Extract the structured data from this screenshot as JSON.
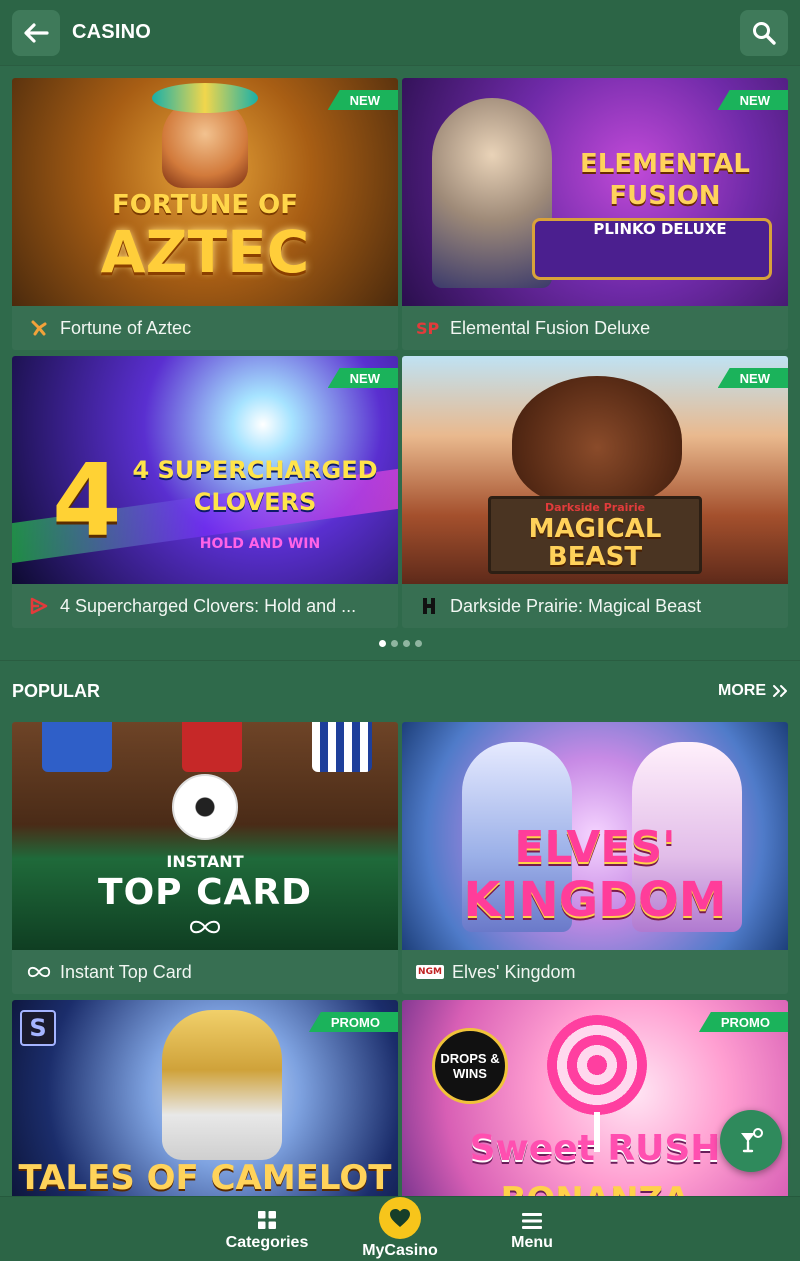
{
  "header": {
    "title": "CASINO",
    "back_icon": "arrow-left-icon",
    "search_icon": "search-icon"
  },
  "featured": [
    {
      "name": "Fortune of Aztec",
      "badge": "NEW",
      "art_line1": "FORTUNE OF",
      "art_line2": "AZTEC"
    },
    {
      "name": "Elemental Fusion Deluxe",
      "badge": "NEW",
      "art_line1": "ELEMENTAL FUSION",
      "art_line2": "PLINKO DELUXE"
    },
    {
      "name": "4 Supercharged Clovers: Hold and ...",
      "badge": "NEW",
      "art_line1": "4 SUPERCHARGED CLOVERS",
      "art_line2": "HOLD AND WIN"
    },
    {
      "name": "Darkside Prairie: Magical Beast",
      "badge": "NEW",
      "art_line0": "Darkside Prairie",
      "art_line1": "MAGICAL",
      "art_line2": "BEAST"
    }
  ],
  "carousel": {
    "pages": 4,
    "active": 0
  },
  "popular": {
    "title": "POPULAR",
    "more_label": "MORE",
    "games": [
      {
        "name": "Instant Top Card",
        "badge": "",
        "art_line1": "INSTANT",
        "art_line2": "TOP CARD"
      },
      {
        "name": "Elves' Kingdom",
        "badge": "",
        "art_line1": "ELVES'",
        "art_line2": "KINGDOM",
        "provider_text": "NGM"
      },
      {
        "name": "Tales of Camelot",
        "badge": "PROMO",
        "art_line1": "TALES OF CAMELOT"
      },
      {
        "name": "Sweet Rush Bonanza",
        "badge": "PROMO",
        "art_line0": "DROPS & WINS",
        "art_line1": "Sweet RUSH",
        "art_line2": "BONANZA"
      }
    ]
  },
  "bottom_nav": {
    "categories": "Categories",
    "mycasino": "MyCasino",
    "menu": "Menu"
  },
  "colors": {
    "background": "#2f6a4b",
    "badge": "#1bb35b",
    "accent_yellow": "#f7c51b"
  }
}
